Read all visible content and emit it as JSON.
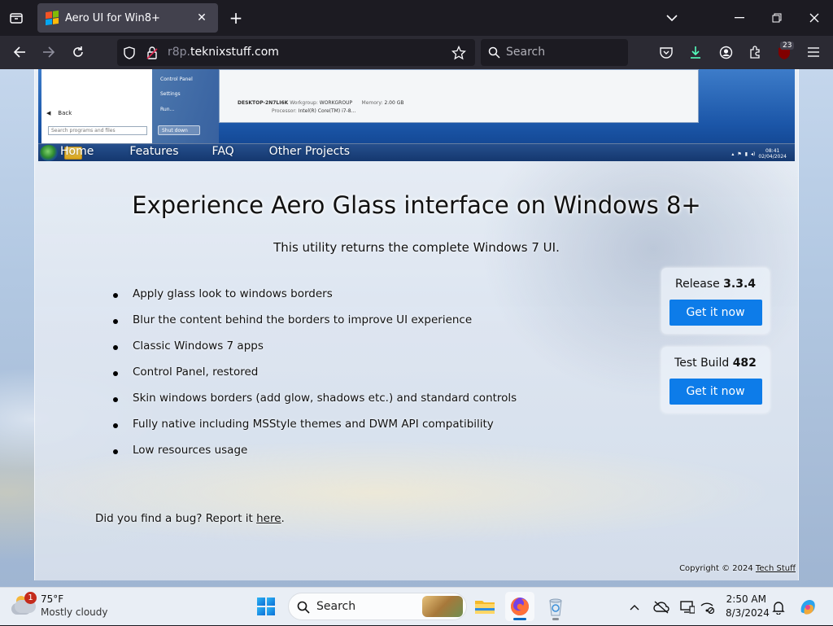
{
  "browser": {
    "tab_title": "Aero UI for Win8+",
    "url_prefix": "r8p.",
    "url_domain": "teknixstuff.com",
    "search_placeholder": "Search",
    "extensions_badge": "23"
  },
  "site": {
    "nav": [
      "Home",
      "Features",
      "FAQ",
      "Other Projects"
    ],
    "headline": "Experience Aero Glass interface on Windows 8+",
    "subhead": "This utility returns the complete Windows 7 UI.",
    "features": [
      "Apply glass look to windows borders",
      "Blur the content behind the borders to improve UI experience",
      "Classic Windows 7 apps",
      "Control Panel, restored",
      "Skin windows borders (add glow, shadows etc.) and standard controls",
      "Fully native including MSStyle themes and DWM API compatibility",
      "Low resources usage"
    ],
    "release": {
      "label": "Release",
      "version": "3.3.4",
      "button": "Get it now"
    },
    "test_build": {
      "label": "Test Build",
      "version": "482",
      "button": "Get it now"
    },
    "bug_text": "Did you find a bug? Report it ",
    "bug_link": "here",
    "bug_end": ".",
    "copyright_text": "Copyright © 2024 ",
    "copyright_link": "Tech Stuff",
    "hero": {
      "start_back": "Back",
      "start_search": "Search programs and files",
      "start_items": [
        "Control Panel",
        "Settings",
        "Run..."
      ],
      "shutdown": "Shut down",
      "computer_name": "DESKTOP-2N7LI6K",
      "workgroup_label": "Workgroup:",
      "workgroup": "WORKGROUP",
      "memory_label": "Memory:",
      "memory": "2.00 GB",
      "processor_label": "Processor:",
      "processor": "Intel(R) Core(TM) i7-8...",
      "time": "08:41",
      "date": "02/04/2024"
    }
  },
  "taskbar": {
    "weather_badge": "1",
    "temperature": "75°F",
    "condition": "Mostly cloudy",
    "search_label": "Search",
    "time": "2:50 AM",
    "date": "8/3/2024"
  },
  "colors": {
    "accent_button": "#0d7ce9",
    "browser_dark": "#1c1b22",
    "toolbar": "#2b2a33"
  }
}
